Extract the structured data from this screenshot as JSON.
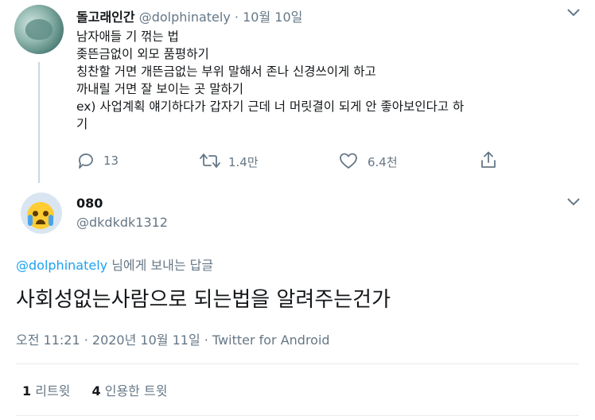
{
  "tweet1": {
    "display_name": "돌고래인간",
    "handle": "@dolphinately",
    "separator": "·",
    "date": "10월 10일",
    "lines": [
      "남자애들 기 꺾는 법",
      "좆뜬금없이 외모 품평하기",
      "칭찬할 거면 개뜬금없는 부위 말해서 존나 신경쓰이게 하고",
      "까내릴 거면 잘 보이는 곳 말하기",
      "ex) 사업계획 얘기하다가 갑자기 근데 너 머릿결이 되게 안 좋아보인다고 하",
      "기"
    ],
    "reply_count": "13",
    "retweet_count": "1.4만",
    "like_count": "6.4천",
    "icons": [
      "reply-icon",
      "retweet-icon",
      "like-icon",
      "share-icon",
      "chevron-down-icon"
    ]
  },
  "tweet2": {
    "display_name": "080",
    "handle": "@dkdkdk1312",
    "reply_to_handle": "@dolphinately",
    "reply_to_suffix": " 님에게 보내는 답글",
    "text": "사회성없는사람으로 되는법을 알려주는건가",
    "timestamp": "오전 11:21 · 2020년 10월 11일 · Twitter for Android",
    "retweet_number": "1",
    "retweet_label": "리트윗",
    "quote_number": "4",
    "quote_label": "인용한 트윗"
  },
  "colors": {
    "accent": "#1da1f2",
    "text": "#14171a",
    "muted": "#657786",
    "divider": "#e6ecf0"
  }
}
